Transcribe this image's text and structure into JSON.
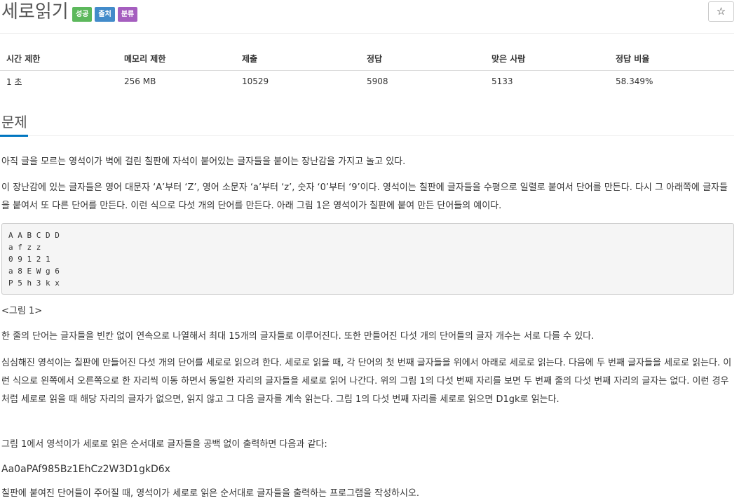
{
  "problem": {
    "title": "세로읽기",
    "badges": [
      "성공",
      "출처",
      "분류"
    ],
    "star_icon": "☆"
  },
  "stats": {
    "headers": [
      "시간 제한",
      "메모리 제한",
      "제출",
      "정답",
      "맞은 사람",
      "정답 비율"
    ],
    "values": [
      "1 초",
      "256 MB",
      "10529",
      "5908",
      "5133",
      "58.349%"
    ]
  },
  "section": {
    "title": "문제"
  },
  "body": {
    "p1": "아직 글을 모르는 영석이가 벽에 걸린 칠판에 자석이 붙어있는 글자들을 붙이는 장난감을 가지고 놀고 있다.",
    "p2": "이 장난감에 있는 글자들은 영어 대문자 ‘A’부터 ‘Z’, 영어 소문자 ‘a’부터 ‘z’, 숫자 ‘0’부터 ‘9’이다. 영석이는 칠판에 글자들을 수평으로 일렬로 붙여서 단어를 만든다. 다시 그 아래쪽에 글자들을 붙여서 또 다른 단어를 만든다. 이런 식으로 다섯 개의 단어를 만든다. 아래 그림 1은 영석이가 칠판에 붙여 만든 단어들의 예이다.",
    "sample": "A A B C D D\na f z z\n0 9 1 2 1\na 8 E W g 6\nP 5 h 3 k x",
    "caption": "<그림 1>",
    "p3": "한 줄의 단어는 글자들을 빈칸 없이 연속으로 나열해서 최대 15개의 글자들로 이루어진다. 또한 만들어진 다섯 개의 단어들의 글자 개수는 서로 다를 수 있다.",
    "p4": "심심해진 영석이는 칠판에 만들어진 다섯 개의 단어를 세로로 읽으려 한다. 세로로 읽을 때, 각 단어의 첫 번째 글자들을 위에서 아래로 세로로 읽는다. 다음에 두 번째 글자들을 세로로 읽는다. 이런 식으로 왼쪽에서 오른쪽으로 한 자리씩 이동 하면서 동일한 자리의 글자들을 세로로 읽어 나간다. 위의 그림 1의 다섯 번째 자리를 보면 두 번째 줄의 다섯 번째 자리의 글자는 없다. 이런 경우처럼 세로로 읽을 때 해당 자리의 글자가 없으면, 읽지 않고 그 다음 글자를 계속 읽는다. 그림 1의 다섯 번째 자리를 세로로 읽으면 D1gk로 읽는다.",
    "p5": "그림 1에서 영석이가 세로로 읽은 순서대로 글자들을 공백 없이 출력하면 다음과 같다:",
    "p6": "Aa0aPAf985Bz1EhCz2W3D1gkD6x",
    "p7": "칠판에 붙여진 단어들이 주어질 때, 영석이가 세로로 읽은 순서대로 글자들을 출력하는 프로그램을 작성하시오."
  }
}
